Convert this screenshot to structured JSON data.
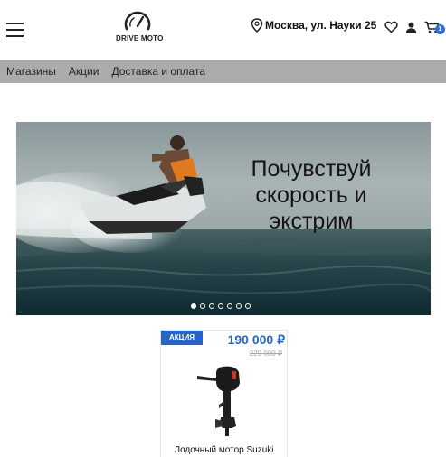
{
  "header": {
    "logo_text": "DRIVE MOTO",
    "location": "Москва, ул. Науки 25",
    "cart_count": "1"
  },
  "nav": {
    "items": [
      "Магазины",
      "Акции",
      "Доставка и оплата"
    ]
  },
  "banner": {
    "headline": "Почувствуй скорость и экстрим",
    "slides_total": 7,
    "active_slide": 1
  },
  "product": {
    "badge": "АКЦИЯ",
    "price": "190 000 ₽",
    "old_price": "229 000 ₽",
    "name": "Лодочный мотор Suzuki"
  },
  "colors": {
    "accent": "#2463c8",
    "nav_bg": "#ababab"
  },
  "icons": [
    "menu-icon",
    "speedometer-logo-icon",
    "location-pin-icon",
    "heart-icon",
    "user-icon",
    "cart-icon"
  ]
}
